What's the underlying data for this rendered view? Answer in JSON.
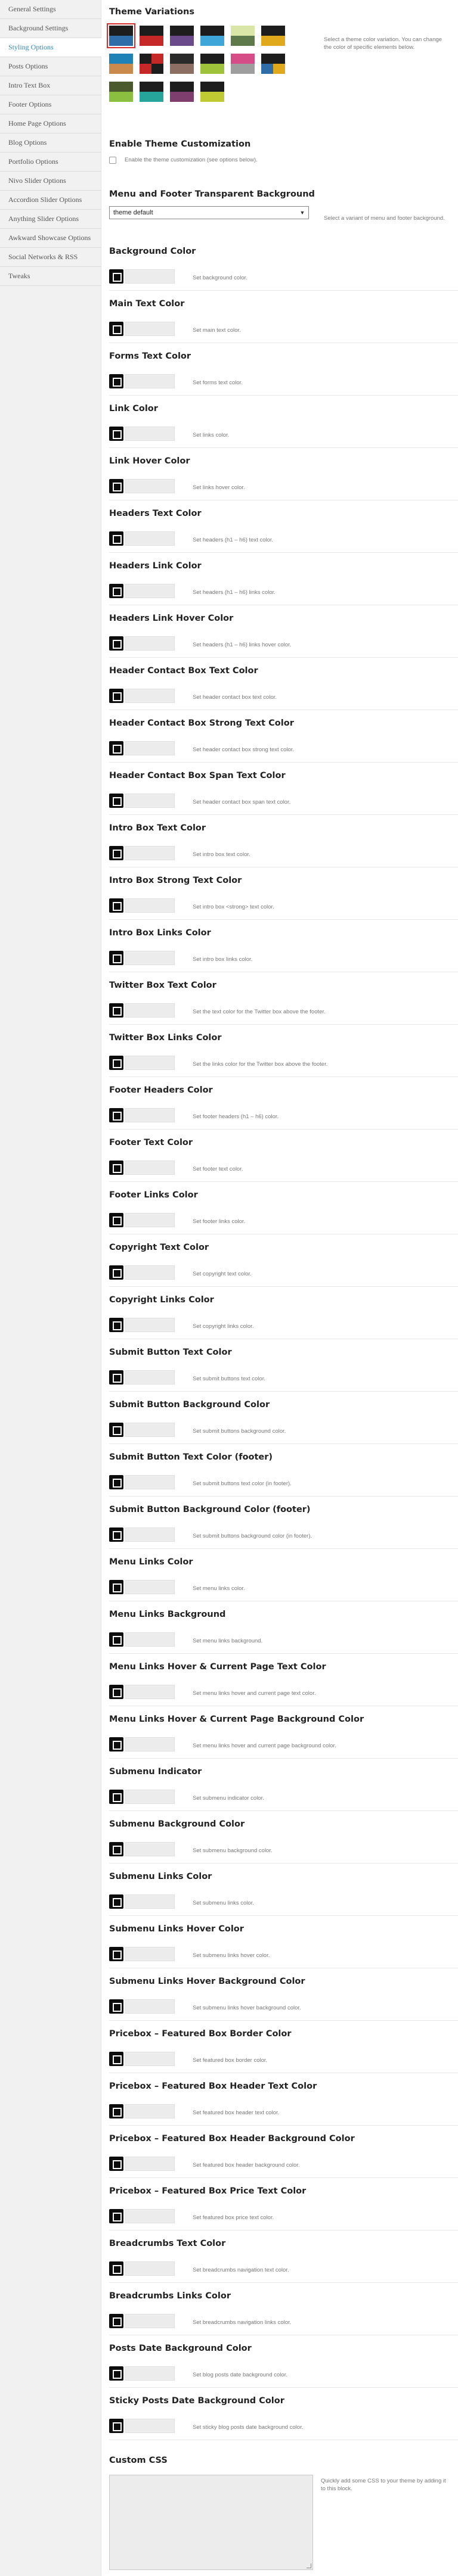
{
  "sidebar": {
    "items": [
      {
        "label": "General Settings",
        "active": false
      },
      {
        "label": "Background Settings",
        "active": false
      },
      {
        "label": "Styling Options",
        "active": true
      },
      {
        "label": "Posts Options",
        "active": false
      },
      {
        "label": "Intro Text Box",
        "active": false
      },
      {
        "label": "Footer Options",
        "active": false
      },
      {
        "label": "Home Page Options",
        "active": false
      },
      {
        "label": "Blog Options",
        "active": false
      },
      {
        "label": "Portfolio Options",
        "active": false
      },
      {
        "label": "Nivo Slider Options",
        "active": false
      },
      {
        "label": "Accordion Slider Options",
        "active": false
      },
      {
        "label": "Anything Slider Options",
        "active": false
      },
      {
        "label": "Awkward Showcase Options",
        "active": false
      },
      {
        "label": "Social Networks & RSS",
        "active": false
      },
      {
        "label": "Tweaks",
        "active": false
      }
    ]
  },
  "theme_variations": {
    "title": "Theme Variations",
    "description": "Select a theme color variation. You can change the color of specific elements below.",
    "swatches": [
      {
        "colors": [
          "#1d1d1d",
          "#1d1d1d",
          "#2f6da8",
          "#2f6da8"
        ],
        "selected": true
      },
      {
        "colors": [
          "#1d1d1d",
          "#1d1d1d",
          "#c62828",
          "#c62828"
        ],
        "selected": false
      },
      {
        "colors": [
          "#1d1d1d",
          "#1d1d1d",
          "#6a4a8a",
          "#6a4a8a"
        ],
        "selected": false
      },
      {
        "colors": [
          "#1d1d1d",
          "#1d1d1d",
          "#3fa6d9",
          "#3fa6d9"
        ],
        "selected": false
      },
      {
        "colors": [
          "#d9e6a7",
          "#d9e6a7",
          "#5e7a4a",
          "#5e7a4a"
        ],
        "selected": false
      },
      {
        "colors": [
          "#1d1d1d",
          "#1d1d1d",
          "#e0a81b",
          "#e0a81b"
        ],
        "selected": false
      },
      {
        "colors": [
          "#1e82b6",
          "#1e82b6",
          "#c98a4b",
          "#c98a4b"
        ],
        "selected": false
      },
      {
        "colors": [
          "#1d1d1d",
          "#c62828",
          "#c62828",
          "#1d1d1d"
        ],
        "selected": false
      },
      {
        "colors": [
          "#2a2a2a",
          "#2a2a2a",
          "#8d6e63",
          "#8d6e63"
        ],
        "selected": false
      },
      {
        "colors": [
          "#1d1d1d",
          "#1d1d1d",
          "#9ec23a",
          "#9ec23a"
        ],
        "selected": false
      },
      {
        "colors": [
          "#d54c86",
          "#d54c86",
          "#9e9e9e",
          "#9e9e9e"
        ],
        "selected": false
      },
      {
        "colors": [
          "#1d1d1d",
          "#1d1d1d",
          "#2f6da8",
          "#e0a81b"
        ],
        "selected": false
      },
      {
        "colors": [
          "#4a5a2e",
          "#4a5a2e",
          "#8bbf3f",
          "#8bbf3f"
        ],
        "selected": false
      },
      {
        "colors": [
          "#1d1d1d",
          "#1d1d1d",
          "#26a69a",
          "#26a69a"
        ],
        "selected": false
      },
      {
        "colors": [
          "#1d1d1d",
          "#1d1d1d",
          "#7e3f6f",
          "#7e3f6f"
        ],
        "selected": false
      },
      {
        "colors": [
          "#1d1d1d",
          "#1d1d1d",
          "#c0ca33",
          "#c0ca33"
        ],
        "selected": false
      }
    ]
  },
  "enable_customization": {
    "title": "Enable Theme Customization",
    "checkbox_label": "Enable the theme customization (see options below)."
  },
  "menu_footer_transparent": {
    "title": "Menu and Footer Transparent Background",
    "selected_value": "theme default",
    "description": "Select a variant of menu and footer background."
  },
  "color_options": [
    {
      "title": "Background Color",
      "description": "Set background color."
    },
    {
      "title": "Main Text Color",
      "description": "Set main text color."
    },
    {
      "title": "Forms Text Color",
      "description": "Set forms text color."
    },
    {
      "title": "Link Color",
      "description": "Set links color."
    },
    {
      "title": "Link Hover Color",
      "description": "Set links hover color."
    },
    {
      "title": "Headers Text Color",
      "description": "Set headers (h1 – h6) text color."
    },
    {
      "title": "Headers Link Color",
      "description": "Set headers (h1 – h6) links color."
    },
    {
      "title": "Headers Link Hover Color",
      "description": "Set headers (h1 – h6) links hover color."
    },
    {
      "title": "Header Contact Box Text Color",
      "description": "Set header contact box text color."
    },
    {
      "title": "Header Contact Box Strong Text Color",
      "description": "Set header contact box strong text color."
    },
    {
      "title": "Header Contact Box Span Text Color",
      "description": "Set header contact box span text color."
    },
    {
      "title": "Intro Box Text Color",
      "description": "Set intro box text color."
    },
    {
      "title": "Intro Box Strong Text Color",
      "description": "Set intro box <strong> text color."
    },
    {
      "title": "Intro Box Links Color",
      "description": "Set intro box links color."
    },
    {
      "title": "Twitter Box Text Color",
      "description": "Set the text color for the Twitter box above the footer."
    },
    {
      "title": "Twitter Box Links Color",
      "description": "Set the links color for the Twitter box above the footer."
    },
    {
      "title": "Footer Headers Color",
      "description": "Set footer headers (h1 – h6) color."
    },
    {
      "title": "Footer Text Color",
      "description": "Set footer text color."
    },
    {
      "title": "Footer Links Color",
      "description": "Set footer links color."
    },
    {
      "title": "Copyright Text Color",
      "description": "Set copyright text color."
    },
    {
      "title": "Copyright Links Color",
      "description": "Set copyright links color."
    },
    {
      "title": "Submit Button Text Color",
      "description": "Set submit buttons text color."
    },
    {
      "title": "Submit Button Background Color",
      "description": "Set submit buttons background color."
    },
    {
      "title": "Submit Button Text Color (footer)",
      "description": "Set submit buttons text color (in footer)."
    },
    {
      "title": "Submit Button Background Color (footer)",
      "description": "Set submit buttons background color (in footer)."
    },
    {
      "title": "Menu Links Color",
      "description": "Set menu links color."
    },
    {
      "title": "Menu Links Background",
      "description": "Set menu links background."
    },
    {
      "title": "Menu Links Hover & Current Page Text Color",
      "description": "Set menu links hover and current page text color."
    },
    {
      "title": "Menu Links Hover & Current Page Background Color",
      "description": "Set menu links hover and current page background color."
    },
    {
      "title": "Submenu Indicator",
      "description": "Set submenu indicator color."
    },
    {
      "title": "Submenu Background Color",
      "description": "Set submenu background color."
    },
    {
      "title": "Submenu Links Color",
      "description": "Set submenu links color."
    },
    {
      "title": "Submenu Links Hover Color",
      "description": "Set submenu links hover color."
    },
    {
      "title": "Submenu Links Hover Background Color",
      "description": "Set submenu links hover background color."
    },
    {
      "title": "Pricebox – Featured Box Border Color",
      "description": "Set featured box border color."
    },
    {
      "title": "Pricebox – Featured Box Header Text Color",
      "description": "Set featured box header text color."
    },
    {
      "title": "Pricebox – Featured Box Header Background Color",
      "description": "Set featured box header background color."
    },
    {
      "title": "Pricebox – Featured Box Price Text Color",
      "description": "Set featured box price text color."
    },
    {
      "title": "Breadcrumbs Text Color",
      "description": "Set breadcrumbs navigation text color."
    },
    {
      "title": "Breadcrumbs Links Color",
      "description": "Set breadcrumbs navigation links color."
    },
    {
      "title": "Posts Date Background Color",
      "description": "Set blog posts date background color."
    },
    {
      "title": "Sticky Posts Date Background Color",
      "description": "Set sticky blog posts date background color."
    }
  ],
  "custom_css": {
    "title": "Custom CSS",
    "description": "Quickly add some CSS to your theme by adding it to this block."
  }
}
